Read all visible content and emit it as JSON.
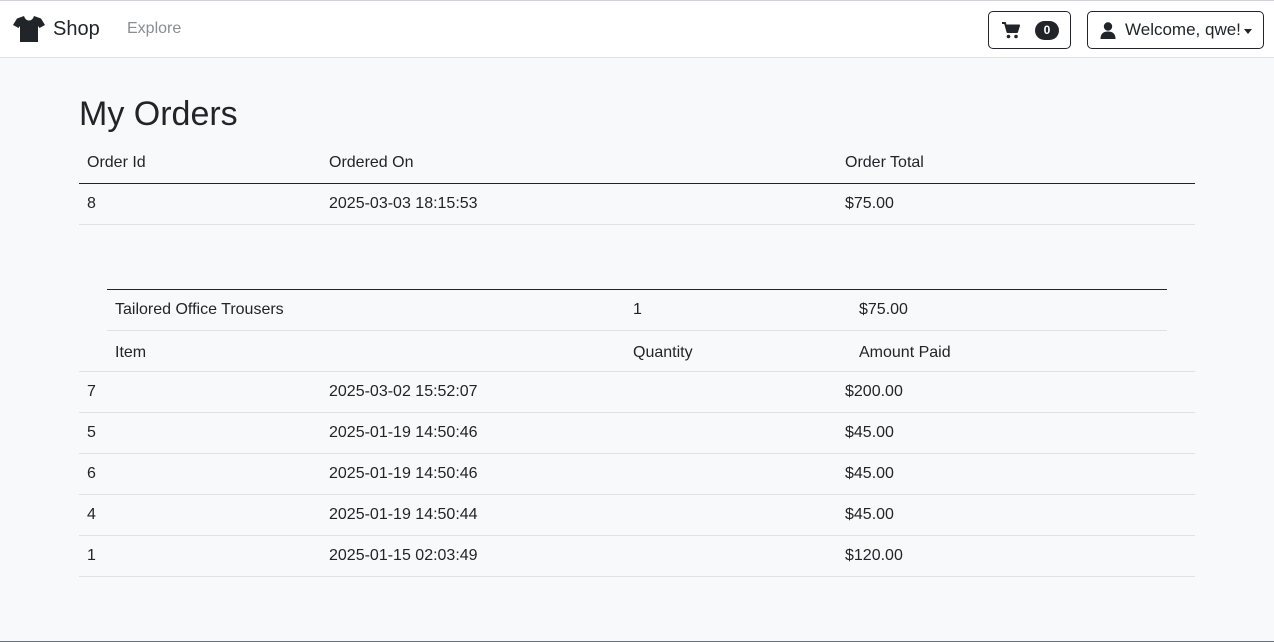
{
  "nav": {
    "brand": "Shop",
    "explore": "Explore",
    "cart_count": "0",
    "user_label": "Welcome, qwe!"
  },
  "page": {
    "title": "My Orders"
  },
  "orders_table": {
    "headers": [
      "Order Id",
      "Ordered On",
      "Order Total"
    ],
    "rows": [
      {
        "id": "8",
        "date": "2025-03-03 18:15:53",
        "total": "$75.00"
      },
      {
        "id": "7",
        "date": "2025-03-02 15:52:07",
        "total": "$200.00"
      },
      {
        "id": "5",
        "date": "2025-01-19 14:50:46",
        "total": "$45.00"
      },
      {
        "id": "6",
        "date": "2025-01-19 14:50:46",
        "total": "$45.00"
      },
      {
        "id": "4",
        "date": "2025-01-19 14:50:44",
        "total": "$45.00"
      },
      {
        "id": "1",
        "date": "2025-01-15 02:03:49",
        "total": "$120.00"
      }
    ]
  },
  "order_details": {
    "headers": [
      "Item",
      "Quantity",
      "Amount Paid"
    ],
    "rows": [
      {
        "item": "Tailored Office Trousers",
        "quantity": "1",
        "amount": "$75.00"
      }
    ]
  }
}
